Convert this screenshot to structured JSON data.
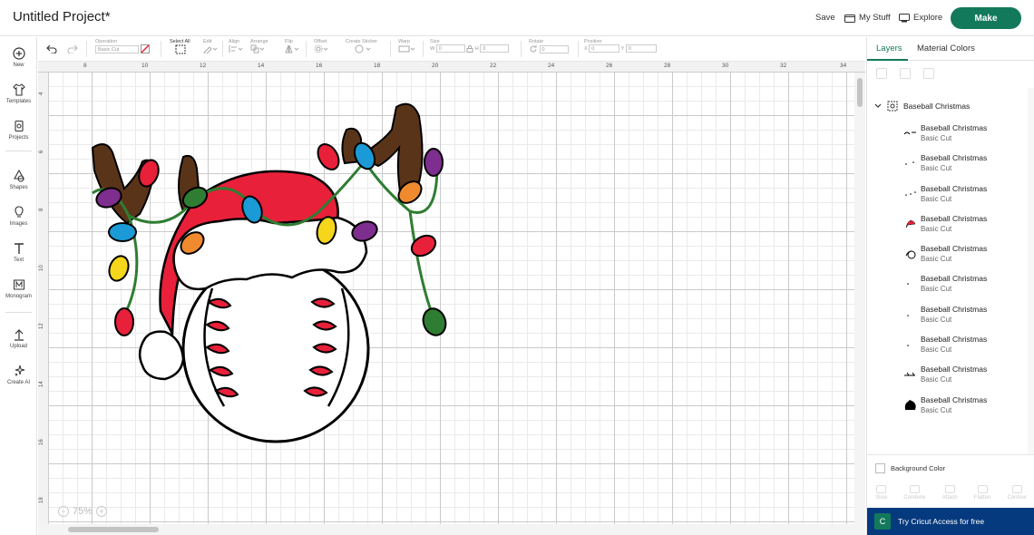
{
  "header": {
    "title": "Untitled Project*",
    "save_label": "Save",
    "mystuff_label": "My Stuff",
    "explore_label": "Explore",
    "make_label": "Make"
  },
  "leftbar": {
    "items": [
      {
        "label": "New",
        "icon": "plus-circle-icon"
      },
      {
        "label": "Templates",
        "icon": "shirt-icon"
      },
      {
        "label": "Projects",
        "icon": "projects-icon"
      },
      {
        "label": "Shapes",
        "icon": "shapes-icon"
      },
      {
        "label": "Images",
        "icon": "lightbulb-icon"
      },
      {
        "label": "Text",
        "icon": "text-icon"
      },
      {
        "label": "Monogram",
        "icon": "monogram-icon"
      },
      {
        "label": "Upload",
        "icon": "upload-icon"
      },
      {
        "label": "Create AI",
        "icon": "sparkle-icon"
      }
    ]
  },
  "toolbar": {
    "operation_label": "Operation",
    "operation_value": "Basic Cut",
    "select_all_label": "Select All",
    "edit_label": "Edit",
    "align_label": "Align",
    "arrange_label": "Arrange",
    "flip_label": "Flip",
    "offset_label": "Offset",
    "create_sticker_label": "Create Sticker",
    "warp_label": "Warp",
    "size_label": "Size",
    "w_label": "W",
    "w_value": "0",
    "h_label": "H",
    "h_value": "0",
    "rotate_label": "Rotate",
    "rotate_value": "0",
    "position_label": "Position",
    "x_label": "X",
    "x_value": "0",
    "y_label": "Y",
    "y_value": "0"
  },
  "canvas": {
    "ruler_top": [
      "8",
      "10",
      "12",
      "14",
      "16",
      "18",
      "20",
      "22",
      "24",
      "26",
      "28",
      "30",
      "32",
      "34"
    ],
    "ruler_left": [
      "4",
      "6",
      "8",
      "10",
      "12",
      "14",
      "16",
      "18"
    ],
    "zoom_value": "75%",
    "design_name": "Baseball Christmas"
  },
  "rpanel": {
    "tabs": [
      "Layers",
      "Material Colors"
    ],
    "group_name": "Baseball Christmas",
    "layers": [
      {
        "name": "Baseball Christmas",
        "sub": "Basic Cut"
      },
      {
        "name": "Baseball Christmas",
        "sub": "Basic Cut"
      },
      {
        "name": "Baseball Christmas",
        "sub": "Basic Cut"
      },
      {
        "name": "Baseball Christmas",
        "sub": "Basic Cut"
      },
      {
        "name": "Baseball Christmas",
        "sub": "Basic Cut"
      },
      {
        "name": "Baseball Christmas",
        "sub": "Basic Cut"
      },
      {
        "name": "Baseball Christmas",
        "sub": "Basic Cut"
      },
      {
        "name": "Baseball Christmas",
        "sub": "Basic Cut"
      },
      {
        "name": "Baseball Christmas",
        "sub": "Basic Cut"
      },
      {
        "name": "Baseball Christmas",
        "sub": "Basic Cut"
      }
    ],
    "background_color_label": "Background Color",
    "bottom_actions": [
      "Slice",
      "Combine",
      "Attach",
      "Flatten",
      "Contour"
    ],
    "access_label": "Try Cricut Access for free"
  },
  "colors": {
    "brand_green": "#13795b",
    "access_blue": "#063a7e",
    "hat_red": "#e8203a",
    "antler_brown": "#5a3418",
    "wire_green": "#2f7d32"
  }
}
